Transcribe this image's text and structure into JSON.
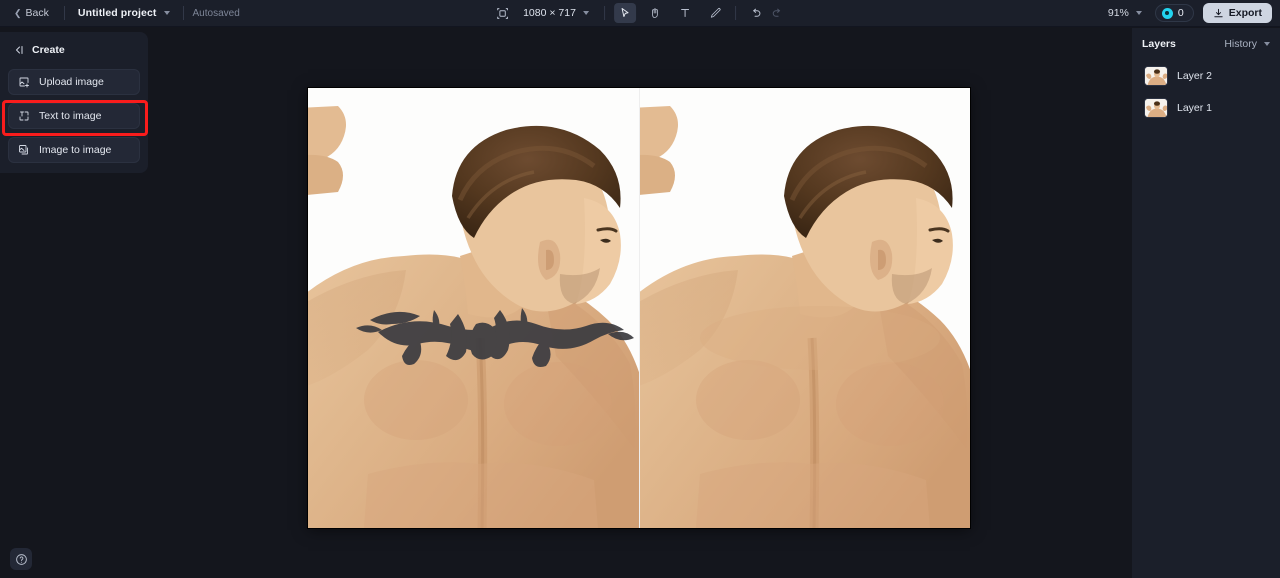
{
  "header": {
    "back_label": "Back",
    "project_name": "Untitled project",
    "autosaved_label": "Autosaved",
    "resize_icon": "resize-icon",
    "dimensions": "1080 × 717",
    "tools": [
      {
        "name": "select-tool",
        "icon": "cursor-icon",
        "active": true
      },
      {
        "name": "pan-tool",
        "icon": "hand-icon",
        "active": false
      },
      {
        "name": "text-tool",
        "icon": "text-icon",
        "active": false
      },
      {
        "name": "brush-tool",
        "icon": "brush-icon",
        "active": false
      }
    ],
    "undo_icon": "undo-icon",
    "redo_icon": "redo-icon",
    "zoom_level": "91%",
    "credits_count": "0",
    "credits_icon": "credit-coin-icon",
    "export_label": "Export",
    "export_icon": "download-icon"
  },
  "sidebar": {
    "title": "Create",
    "collapse_icon": "collapse-left-icon",
    "items": [
      {
        "label": "Upload image",
        "icon": "upload-image-icon",
        "highlighted": true
      },
      {
        "label": "Text to image",
        "icon": "text-to-image-icon",
        "highlighted": false
      },
      {
        "label": "Image to image",
        "icon": "image-to-image-icon",
        "highlighted": false
      }
    ],
    "help_icon": "help-circle-icon"
  },
  "right_panel": {
    "title": "Layers",
    "history_label": "History",
    "history_caret_icon": "chevron-down-icon",
    "layers": [
      {
        "name": "Layer 2",
        "thumb_alt": "man-flexing-back-thumbnail"
      },
      {
        "name": "Layer 1",
        "thumb_alt": "man-flexing-back-thumbnail"
      }
    ]
  },
  "canvas": {
    "background_color": "#14161d",
    "artboard_label": "before-after-tattoo-removal",
    "left_image_alt": "Muscular man's upper back with dark tribal tattoo, white background",
    "right_image_alt": "Same man's upper back with tattoo removed, clear skin, white background"
  },
  "colors": {
    "panel_bg": "#1b1f2a",
    "canvas_bg": "#14161d",
    "accent_cyan": "#22d3ee",
    "highlight_red": "#f91c1c",
    "export_bg": "#ced5e1"
  }
}
